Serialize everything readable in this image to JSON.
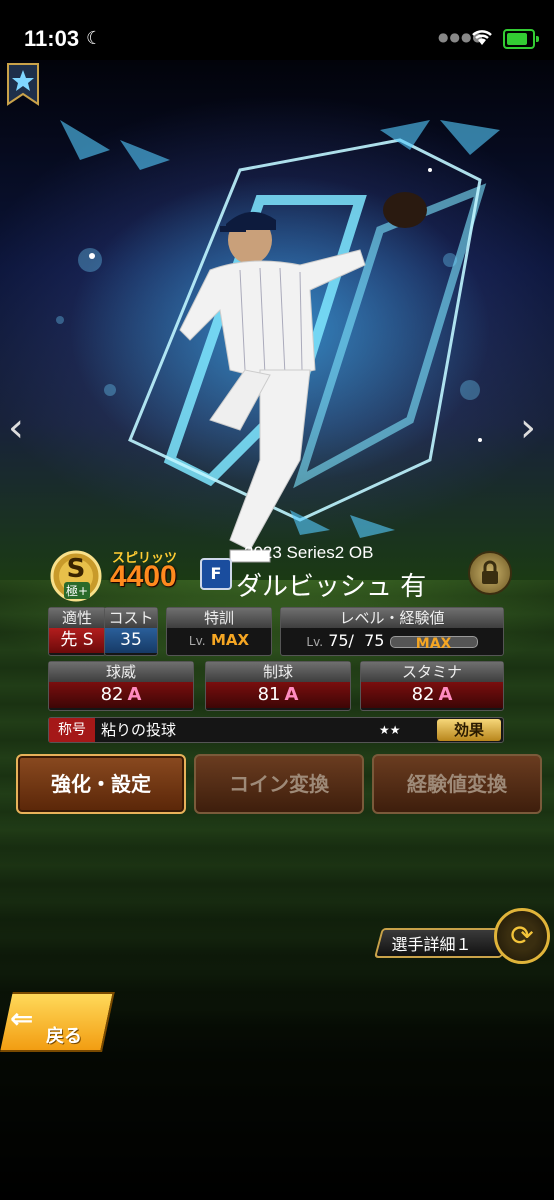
{
  "status_bar": {
    "time": "11:03"
  },
  "card": {
    "spirits_label": "スピリッツ",
    "spirits_value": "4400",
    "team_icon_letter": "F",
    "series": "2023 Series2 OB",
    "player_name": "ダルビッシュ 有",
    "rank": "S",
    "rank_sub": "極+"
  },
  "panels": {
    "aptitude": {
      "label": "適性",
      "value_pos": "先",
      "value_grade": "S"
    },
    "cost": {
      "label": "コスト",
      "value": "35"
    },
    "training": {
      "label": "特訓",
      "lv": "Lv.",
      "value": "MAX"
    },
    "level": {
      "label": "レベル・経験値",
      "lv": "Lv.",
      "value": "75/  75",
      "bar_text": "MAX",
      "exp_fraction": 1.0
    }
  },
  "stats": {
    "power": {
      "label": "球威",
      "value": "82",
      "grade": "A"
    },
    "control": {
      "label": "制球",
      "value": "81",
      "grade": "A"
    },
    "stamina": {
      "label": "スタミナ",
      "value": "82",
      "grade": "A"
    }
  },
  "title_row": {
    "label": "称号",
    "value": "粘りの投球",
    "stars": "★★",
    "effect_label": "効果"
  },
  "buttons": {
    "enhance": "強化・設定",
    "coin": "コイン変換",
    "exp": "経験値変換"
  },
  "detail_tab": "選手詳細１",
  "back": "戻る",
  "colors": {
    "spirits": "#ff8a1e",
    "accent_gold": "#e0b43a",
    "max": "#f5a623",
    "stat_red": "#7a0e0e"
  }
}
